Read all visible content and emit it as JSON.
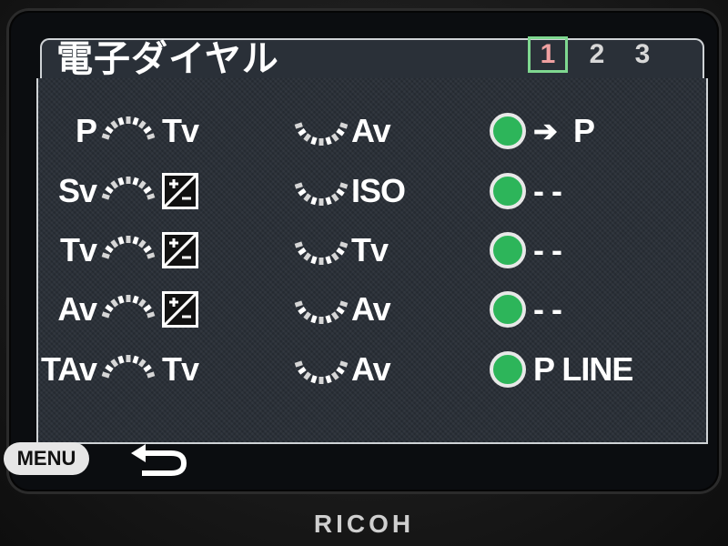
{
  "header": {
    "title": "電子ダイヤル",
    "pages": [
      "1",
      "2",
      "3"
    ],
    "active_page": "1"
  },
  "rows": [
    {
      "mode": "P",
      "front": "Tv",
      "rear": "Av",
      "green": "P",
      "green_prefix": "➔"
    },
    {
      "mode": "Sv",
      "front": "",
      "rear": "ISO",
      "green": "- -",
      "green_prefix": ""
    },
    {
      "mode": "Tv",
      "front": "",
      "rear": "Tv",
      "green": "- -",
      "green_prefix": ""
    },
    {
      "mode": "Av",
      "front": "",
      "rear": "Av",
      "green": "- -",
      "green_prefix": ""
    },
    {
      "mode": "TAv",
      "front": "Tv",
      "rear": "Av",
      "green": "P LINE",
      "green_prefix": ""
    }
  ],
  "footer": {
    "menu_label": "MENU"
  },
  "brand": "RICOH",
  "icons": {
    "front_dial": "front-dial-icon",
    "rear_dial": "rear-dial-icon",
    "ev_comp": "exposure-compensation-icon",
    "green_button": "green-button-icon",
    "back": "back-arrow-icon"
  },
  "colors": {
    "green": "#2db55a",
    "active_page_text": "#f0a0a0",
    "active_page_frame": "#7fd890"
  }
}
